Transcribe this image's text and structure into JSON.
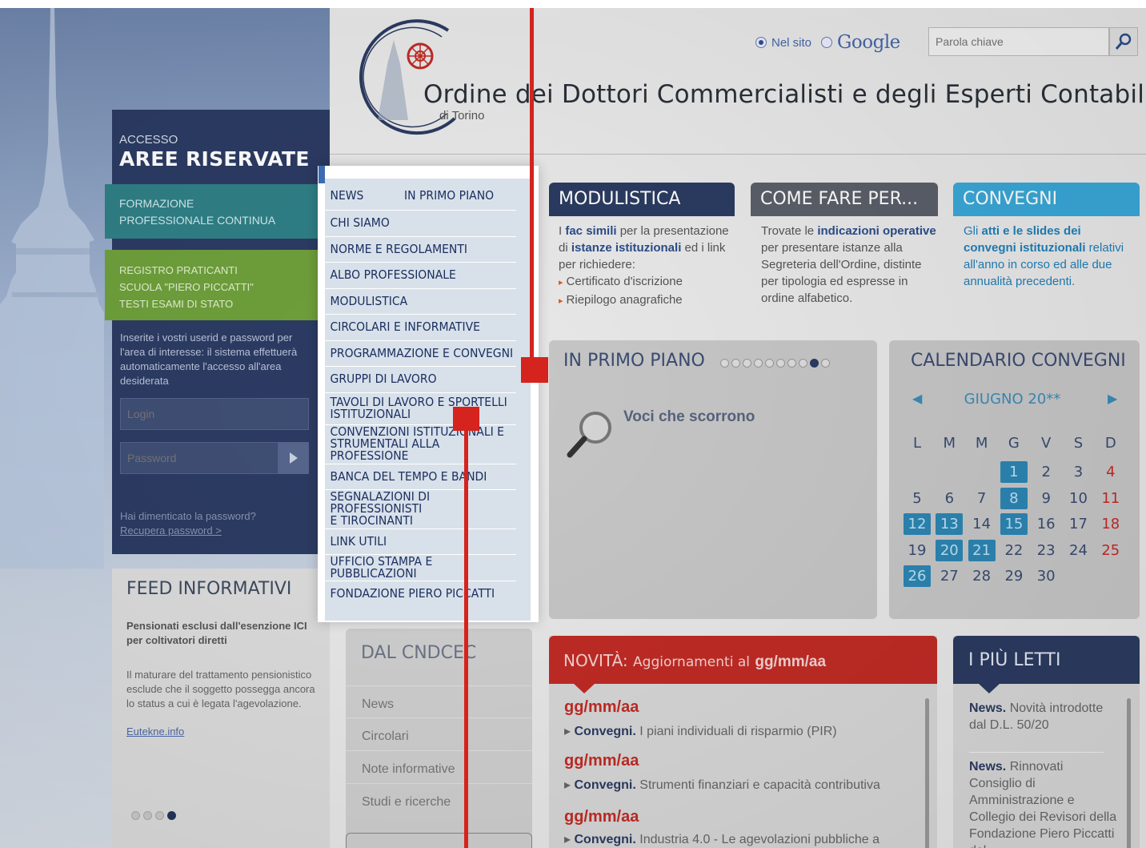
{
  "header": {
    "title": "Ordine dei Dottori Commercialisti e degli Esperti Contabili",
    "subtitle": "di Torino",
    "search_scope_site": "Nel sito",
    "search_scope_google": "Google",
    "search_placeholder": "Parola chiave"
  },
  "access": {
    "label": "ACCESSO",
    "title": "AREE RISERVATE",
    "formazione": "FORMAZIONE\nPROFESSIONALE CONTINUA",
    "registro": "REGISTRO PRATICANTI\nSCUOLA \"PIERO PICCATTI\"\nTESTI ESAMI DI STATO",
    "info": "Inserite i vostri userid e password per l'area di interesse: il sistema effettuerà automaticamente l'accesso all'area desiderata",
    "login_placeholder": "Login",
    "password_placeholder": "Password",
    "forgot_text": "Hai dimenticato la password?",
    "forgot_link": "Recupera password >"
  },
  "feed": {
    "title": "FEED INFORMATIVI",
    "headline": "Pensionati esclusi dall'esenzione ICI per coltivatori diretti",
    "body": "Il maturare del trattamento pensionistico esclude che il soggetto possegga ancora lo status a cui è legata l'agevolazione.",
    "link": "Eutekne.info",
    "active_dot": 4
  },
  "menu": {
    "news": "NEWS",
    "news_secondary": "IN PRIMO PIANO",
    "items": [
      "CHI SIAMO",
      "NORME E REGOLAMENTI",
      "ALBO PROFESSIONALE",
      "MODULISTICA",
      "CIRCOLARI E INFORMATIVE",
      "PROGRAMMAZIONE E CONVEGNI",
      "GRUPPI DI LAVORO",
      "TAVOLI DI LAVORO E SPORTELLI\nISTITUZIONALI",
      "CONVENZIONI ISTITUZIONALI E\nSTRUMENTALI ALLA PROFESSIONE",
      "BANCA DEL TEMPO E BANDI",
      "SEGNALAZIONI DI PROFESSIONISTI\nE TIROCINANTI",
      "LINK UTILI",
      "UFFICIO STAMPA E PUBBLICAZIONI",
      "FONDAZIONE PIERO PICCATTI"
    ]
  },
  "modulistica": {
    "title": "MODULISTICA",
    "t1": "I ",
    "h1": "fac simili",
    "t2": " per la presentazione di ",
    "h2": "istanze istituzionali",
    "t3": " ed i link per richiedere:",
    "bullets": [
      "Certificato d'iscrizione",
      "Riepilogo anagrafiche"
    ]
  },
  "comefare": {
    "title": "COME FARE PER...",
    "t1": "Trovate le ",
    "h1": "indicazioni operative",
    "t2": " per presentare istanze alla Segreteria dell'Ordine, distinte per tipologia ed espresse in ordine alfabetico."
  },
  "convegni": {
    "title": "CONVEGNI",
    "t1": "Gli ",
    "h1": "atti e le slides dei convegni istituzionali",
    "t2": " relativi all'anno in corso ed alle due annualità precedenti."
  },
  "primo_piano": {
    "title": "IN PRIMO PIANO",
    "text": "Voci che scorrono",
    "dots": 10,
    "active_dot": 9
  },
  "calendario": {
    "title": "CALENDARIO CONVEGNI",
    "month": "GIUGNO 20**",
    "weekdays": [
      "L",
      "M",
      "M",
      "G",
      "V",
      "S",
      "D"
    ],
    "first_weekday_index": 3,
    "days": 30,
    "event_days": [
      1,
      8,
      12,
      13,
      15,
      20,
      21,
      26
    ]
  },
  "cndcec": {
    "title": "DAL CNDCEC",
    "items": [
      "News",
      "Circolari",
      "Note informative",
      "Studi e ricerche"
    ]
  },
  "novita": {
    "title": "NOVITÀ:",
    "subtitle": "Aggiornamenti al",
    "date": "gg/mm/aa",
    "entries": [
      {
        "date": "gg/mm/aa",
        "cat": "Convegni.",
        "text": "I piani individuali di risparmio (PIR)"
      },
      {
        "date": "gg/mm/aa",
        "cat": "Convegni.",
        "text": "Strumenti finanziari e capacità contributiva"
      },
      {
        "date": "gg/mm/aa",
        "cat": "Convegni.",
        "text": "Industria 4.0 - Le agevolazioni pubbliche a"
      }
    ]
  },
  "letti": {
    "title": "I PIÙ LETTI",
    "entries": [
      {
        "cat": "News.",
        "text": "Novità introdotte dal D.L. 50/20"
      },
      {
        "cat": "News.",
        "text": "Rinnovati Consiglio di Amministrazione e Collegio dei Revisori della Fondazione Piero Piccatti dal"
      }
    ]
  },
  "colors": {
    "navy": "#2b3b61",
    "teal": "#2f7f86",
    "green": "#6e9f3b",
    "cyan": "#3aa8d8",
    "red": "#c12b25",
    "marker_red": "#d5231d"
  }
}
